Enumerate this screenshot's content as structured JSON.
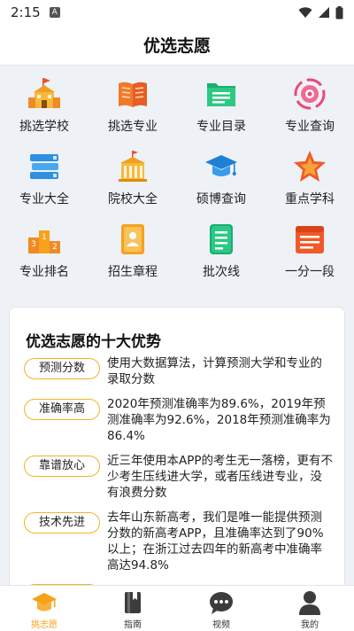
{
  "status": {
    "time": "2:15",
    "notification_glyph": "A"
  },
  "header": {
    "title": "优选志愿"
  },
  "grid": [
    {
      "label": "挑选学校",
      "icon": "school-icon"
    },
    {
      "label": "挑选专业",
      "icon": "book-icon"
    },
    {
      "label": "专业目录",
      "icon": "list-icon"
    },
    {
      "label": "专业查询",
      "icon": "target-icon"
    },
    {
      "label": "专业大全",
      "icon": "books-stack-icon"
    },
    {
      "label": "院校大全",
      "icon": "college-icon"
    },
    {
      "label": "硕博查询",
      "icon": "graduation-cap-icon"
    },
    {
      "label": "重点学科",
      "icon": "star-icon"
    },
    {
      "label": "专业排名",
      "icon": "podium-icon"
    },
    {
      "label": "招生章程",
      "icon": "document-icon"
    },
    {
      "label": "批次线",
      "icon": "notes-icon"
    },
    {
      "label": "一分一段",
      "icon": "score-table-icon"
    }
  ],
  "advantages": {
    "title": "优选志愿的十大优势",
    "items": [
      {
        "tag": "预测分数",
        "text": "使用大数据算法，计算预测大学和专业的录取分数"
      },
      {
        "tag": "准确率高",
        "text": "2020年预测准确率为89.6%，2019年预测准确率为92.6%，2018年预测准确率为86.4%"
      },
      {
        "tag": "靠谱放心",
        "text": "近三年使用本APP的考生无一落榜，更有不少考生压线进大学，或者压线进专业，没有浪费分数"
      },
      {
        "tag": "技术先进",
        "text": "去年山东新高考，我们是唯一能提供预测分数的新高考APP，且准确率达到了90%以上；在浙江过去四年的新高考中准确率高达94.8%"
      }
    ]
  },
  "tabbar": [
    {
      "label": "挑志愿",
      "icon": "graduation-cap-icon",
      "active": true
    },
    {
      "label": "指南",
      "icon": "guide-book-icon",
      "active": false
    },
    {
      "label": "视频",
      "icon": "chat-bubble-icon",
      "active": false
    },
    {
      "label": "我的",
      "icon": "person-icon",
      "active": false
    }
  ],
  "colors": {
    "accent": "#f6a21b",
    "badge_border": "#f3b326",
    "background": "#eef1f5"
  }
}
